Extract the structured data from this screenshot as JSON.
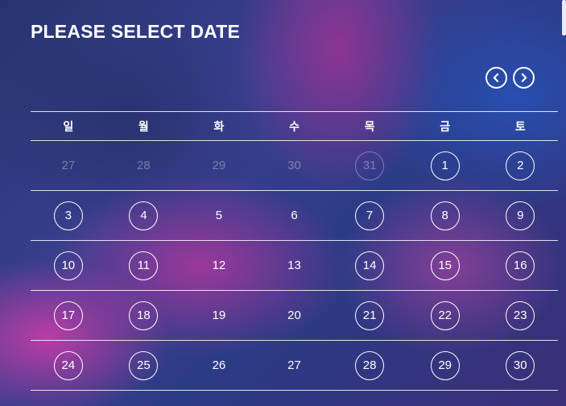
{
  "header": {
    "title": "PLEASE SELECT DATE"
  },
  "nav": {
    "prev_icon": "chevron-left-icon",
    "next_icon": "chevron-right-icon"
  },
  "weekdays": [
    "일",
    "월",
    "화",
    "수",
    "목",
    "금",
    "토"
  ],
  "weeks": [
    [
      {
        "day": "27",
        "available": false,
        "muted": true
      },
      {
        "day": "28",
        "available": false,
        "muted": true
      },
      {
        "day": "29",
        "available": false,
        "muted": true
      },
      {
        "day": "30",
        "available": false,
        "muted": true
      },
      {
        "day": "31",
        "available": true,
        "muted": true
      },
      {
        "day": "1",
        "available": true,
        "muted": false
      },
      {
        "day": "2",
        "available": true,
        "muted": false
      }
    ],
    [
      {
        "day": "3",
        "available": true,
        "muted": false
      },
      {
        "day": "4",
        "available": true,
        "muted": false
      },
      {
        "day": "5",
        "available": false,
        "muted": false
      },
      {
        "day": "6",
        "available": false,
        "muted": false
      },
      {
        "day": "7",
        "available": true,
        "muted": false
      },
      {
        "day": "8",
        "available": true,
        "muted": false
      },
      {
        "day": "9",
        "available": true,
        "muted": false
      }
    ],
    [
      {
        "day": "10",
        "available": true,
        "muted": false
      },
      {
        "day": "11",
        "available": true,
        "muted": false
      },
      {
        "day": "12",
        "available": false,
        "muted": false
      },
      {
        "day": "13",
        "available": false,
        "muted": false
      },
      {
        "day": "14",
        "available": true,
        "muted": false
      },
      {
        "day": "15",
        "available": true,
        "muted": false
      },
      {
        "day": "16",
        "available": true,
        "muted": false
      }
    ],
    [
      {
        "day": "17",
        "available": true,
        "muted": false
      },
      {
        "day": "18",
        "available": true,
        "muted": false
      },
      {
        "day": "19",
        "available": false,
        "muted": false
      },
      {
        "day": "20",
        "available": false,
        "muted": false
      },
      {
        "day": "21",
        "available": true,
        "muted": false
      },
      {
        "day": "22",
        "available": true,
        "muted": false
      },
      {
        "day": "23",
        "available": true,
        "muted": false
      }
    ],
    [
      {
        "day": "24",
        "available": true,
        "muted": false
      },
      {
        "day": "25",
        "available": true,
        "muted": false
      },
      {
        "day": "26",
        "available": false,
        "muted": false
      },
      {
        "day": "27",
        "available": false,
        "muted": false
      },
      {
        "day": "28",
        "available": true,
        "muted": false
      },
      {
        "day": "29",
        "available": true,
        "muted": false
      },
      {
        "day": "30",
        "available": true,
        "muted": false
      }
    ]
  ],
  "colors": {
    "text": "#ffffff",
    "background_blue": "#2c3b86",
    "background_pink": "#c83ca8"
  }
}
